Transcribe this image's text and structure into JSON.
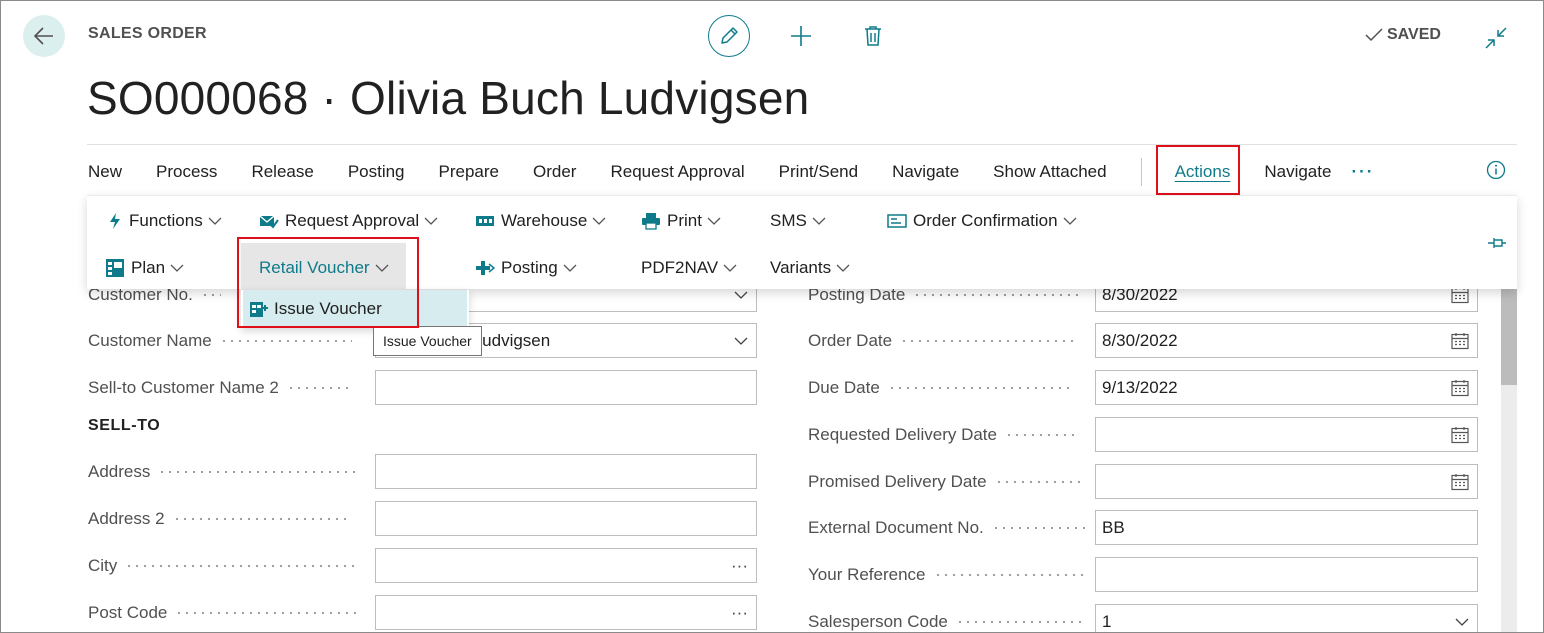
{
  "header": {
    "caption": "SALES ORDER",
    "title": "SO000068 · Olivia Buch Ludvigsen",
    "status": "SAVED"
  },
  "actionbar": {
    "items": [
      "New",
      "Process",
      "Release",
      "Posting",
      "Prepare",
      "Order",
      "Request Approval",
      "Print/Send",
      "Navigate",
      "Show Attached"
    ],
    "actions_label": "Actions",
    "navigate_label": "Navigate",
    "more_label": "···"
  },
  "actions_menu": {
    "row1": [
      "Functions",
      "Request Approval",
      "Warehouse",
      "Print",
      "SMS",
      "Order Confirmation"
    ],
    "row2": [
      "Plan",
      "Retail Voucher",
      "Posting",
      "PDF2NAV",
      "Variants"
    ]
  },
  "submenu": {
    "item": "Issue Voucher",
    "tooltip": "Issue Voucher"
  },
  "form_left": {
    "customer_no_label": "Customer No.",
    "customer_name_label": "Customer Name",
    "customer_name_value": "Olivia Buch Ludvigsen",
    "sell_to_name2_label": "Sell-to Customer Name 2",
    "section_title": "SELL-TO",
    "address_label": "Address",
    "address2_label": "Address 2",
    "city_label": "City",
    "post_code_label": "Post Code",
    "lookup_glyph": "···"
  },
  "form_right": {
    "posting_date_label": "Posting Date",
    "posting_date_value": "8/30/2022",
    "order_date_label": "Order Date",
    "order_date_value": "8/30/2022",
    "due_date_label": "Due Date",
    "due_date_value": "9/13/2022",
    "req_delivery_label": "Requested Delivery Date",
    "prom_delivery_label": "Promised Delivery Date",
    "ext_doc_label": "External Document No.",
    "ext_doc_value": "BB",
    "your_ref_label": "Your Reference",
    "salesperson_label": "Salesperson Code",
    "salesperson_value": "1"
  },
  "colors": {
    "accent": "#0f7b8a",
    "highlight_box": "#e0101a",
    "back_button_bg": "#dcefef"
  },
  "icons": [
    "back-arrow-icon",
    "pencil-icon",
    "plus-icon",
    "trash-icon",
    "checkmark-icon",
    "collapse-icon",
    "info-icon",
    "pin-icon",
    "lightning-icon",
    "approval-icon",
    "warehouse-icon",
    "printer-icon",
    "document-icon",
    "plan-icon",
    "posting-icon",
    "voucher-icon",
    "calendar-icon",
    "chevron-down-icon"
  ]
}
